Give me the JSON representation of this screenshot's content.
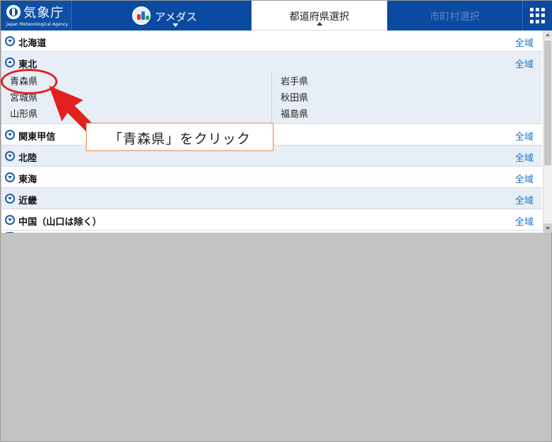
{
  "header": {
    "logo_name": "気象庁",
    "logo_sub": "Japan Meteorological Agency",
    "amedas_label": "アメダス",
    "pref_tab_label": "都道府県選択",
    "city_tab_label": "市町村選択"
  },
  "regions": [
    {
      "name": "北海道",
      "all": "全域"
    },
    {
      "name": "東北",
      "all": "全域"
    },
    {
      "name": "関東甲信",
      "all": "全域"
    },
    {
      "name": "北陸",
      "all": "全域"
    },
    {
      "name": "東海",
      "all": "全域"
    },
    {
      "name": "近畿",
      "all": "全域"
    },
    {
      "name": "中国（山口は除く）",
      "all": "全域"
    }
  ],
  "tohoku_prefectures": [
    "青森県",
    "岩手県",
    "宮城県",
    "秋田県",
    "山形県",
    "福島県"
  ],
  "annotation": {
    "callout_text": "「青森県」をクリック",
    "color": "#e0211d"
  }
}
